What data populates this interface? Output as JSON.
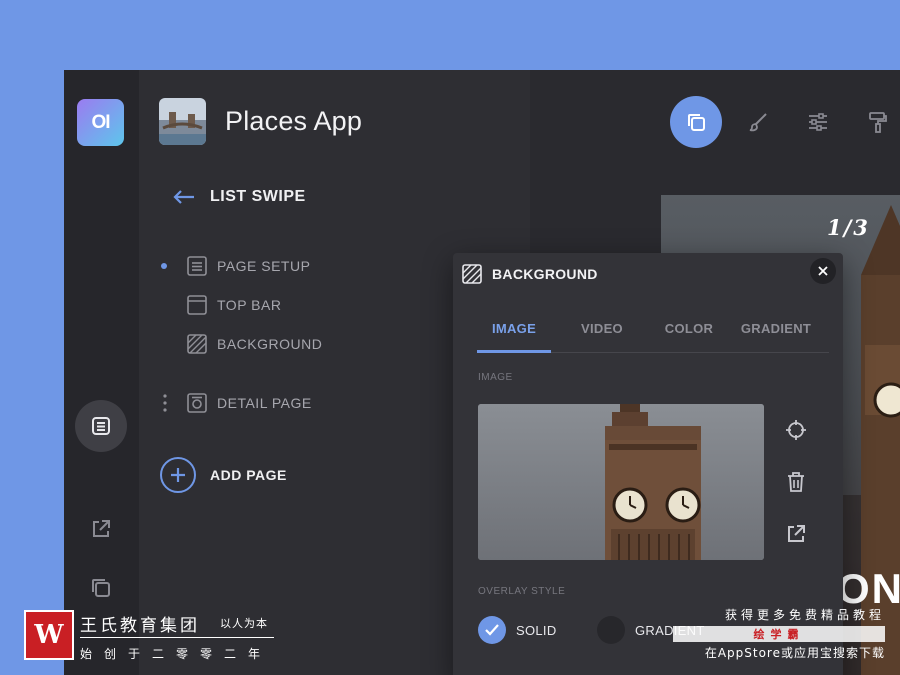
{
  "sidebar": {
    "logo_text": "OI"
  },
  "app": {
    "title": "Places App"
  },
  "nav": {
    "back_label": "LIST SWIPE",
    "items": [
      {
        "label": "PAGE SETUP",
        "icon": "list-icon",
        "active": true
      },
      {
        "label": "TOP BAR",
        "icon": "window-icon"
      },
      {
        "label": "BACKGROUND",
        "icon": "hatch-icon"
      }
    ],
    "detail": {
      "label": "DETAIL PAGE",
      "icon": "detail-page-icon"
    },
    "add_label": "ADD PAGE"
  },
  "preview": {
    "page_indicator": "1/3",
    "big_text": "ON"
  },
  "panel": {
    "title": "BACKGROUND",
    "tabs": [
      {
        "label": "IMAGE",
        "active": true
      },
      {
        "label": "VIDEO"
      },
      {
        "label": "COLOR"
      },
      {
        "label": "GRADIENT"
      }
    ],
    "image_label": "IMAGE",
    "overlay_label": "OVERLAY STYLE",
    "overlay_options": [
      {
        "label": "SOLID",
        "selected": true
      },
      {
        "label": "GRADIENT",
        "selected": false
      }
    ]
  },
  "watermark": {
    "logo_text": "W",
    "name": "王氏教育集团",
    "slogan": "以人为本",
    "founded": "始创于二零零二年",
    "right_line1": "获得更多免费精品教程",
    "right_line2": "绘学霸",
    "right_line3": "在AppStore或应用宝搜索下载"
  },
  "colors": {
    "background": "#6f97e6",
    "accent": "#6f97e6",
    "panel": "#333338",
    "nav": "#2e2e33"
  }
}
